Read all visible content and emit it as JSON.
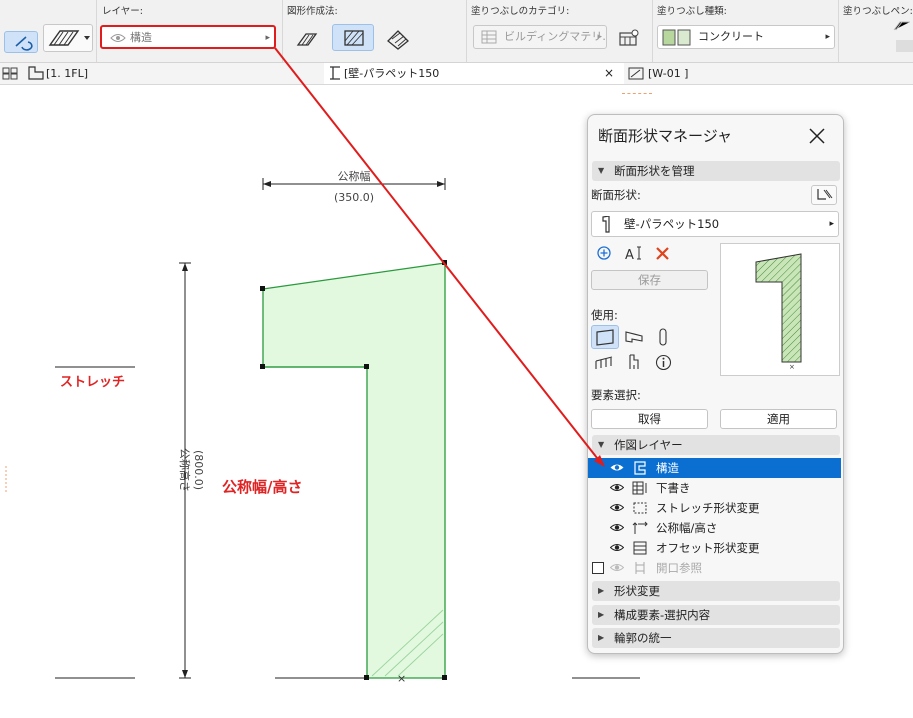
{
  "toolbar": {
    "layer_label": "レイヤー:",
    "layer_value": "構造",
    "geometry_label": "図形作成法:",
    "fill_category_label": "塗りつぶしのカテゴリ:",
    "fill_category_value": "ビルディングマテリ…",
    "fill_type_label": "塗りつぶし種類:",
    "fill_type_value": "コンクリート",
    "fill_pen_label": "塗りつぶしペン:"
  },
  "tabs": {
    "floor": "[1. 1FL]",
    "profile": "[壁-パラペット150",
    "close": "×",
    "elevation": "[W-01 ]"
  },
  "canvas": {
    "nominal_width_label": "公称幅",
    "nominal_width_value": "(350.0)",
    "nominal_height_label": "公称高さ",
    "nominal_height_value": "(800.0)",
    "stretch_annotation": "ストレッチ",
    "nominal_annotation": "公称幅/高さ",
    "annotation_color": "#e02424"
  },
  "panel": {
    "title": "断面形状マネージャ",
    "manage_section": "断面形状を管理",
    "profile_label": "断面形状:",
    "profile_value": "壁-パラペット150",
    "save_button": "保存",
    "usage_label": "使用:",
    "element_select_label": "要素選択:",
    "get_button": "取得",
    "apply_button": "適用",
    "drawing_layers_section": "作図レイヤー",
    "layers": [
      {
        "name": "構造",
        "selected": true,
        "visible": true
      },
      {
        "name": "下書き",
        "selected": false,
        "visible": true
      },
      {
        "name": "ストレッチ形状変更",
        "selected": false,
        "visible": true
      },
      {
        "name": "公称幅/高さ",
        "selected": false,
        "visible": true
      },
      {
        "name": "オフセット形状変更",
        "selected": false,
        "visible": true
      },
      {
        "name": "開口参照",
        "selected": false,
        "visible": false
      }
    ],
    "collapsed_sections": [
      "形状変更",
      "構成要素-選択内容",
      "輪郭の統一"
    ],
    "accent_color": "#0a6fd0"
  }
}
